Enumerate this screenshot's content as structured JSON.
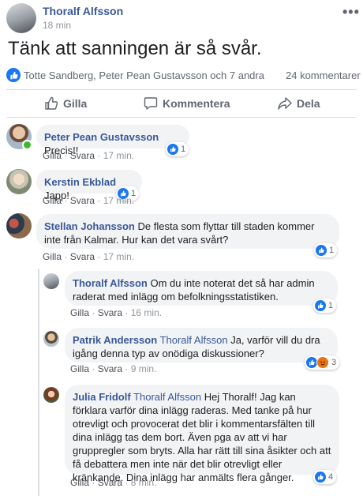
{
  "post": {
    "author": "Thoralf Alfsson",
    "time": "18 min",
    "text": "Tänk att sanningen är så svår.",
    "reactions_summary": "Totte Sandberg, Peter Pean Gustavsson och 7 andra",
    "comments_count": "24 kommentarer",
    "more_icon": "ellipsis-icon"
  },
  "actions": {
    "like": "Gilla",
    "comment": "Kommentera",
    "share": "Dela"
  },
  "comment_links": {
    "like": "Gilla",
    "reply": "Svara",
    "sep": "·"
  },
  "comments": [
    {
      "author": "Peter Pean Gustavsson",
      "text": "Precis!!",
      "time": "17 min.",
      "reactions": "1"
    },
    {
      "author": "Kerstin Ekblad",
      "text": "Japp!",
      "time": "17 min.",
      "reactions": "1"
    },
    {
      "author": "Stellan Johansson",
      "text": "De flesta som flyttar till staden kommer inte från Kalmar. Hur kan det vara svårt?",
      "time": "17 min.",
      "reactions": "1"
    }
  ],
  "replies": [
    {
      "author": "Thoralf Alfsson",
      "tag": "",
      "text": "Om du inte noterat det så har admin raderat med inlägg om befolkningsstatistiken.",
      "time": "16 min.",
      "reactions": "1"
    },
    {
      "author": "Patrik Andersson",
      "tag": "Thoralf Alfsson",
      "text": "Ja, varför vill du dra igång denna typ av onödiga diskussioner?",
      "time": "9 min.",
      "reactions": "3"
    },
    {
      "author": "Julia Fridolf",
      "tag": "Thoralf Alfsson",
      "text": "Hej Thoralf! Jag kan förklara varför dina inlägg raderas. Med tanke på hur otrevligt och provocerat det blir i kommentarsfälten till dina inlägg tas dem bort. Även pga av att vi har gruppregler som bryts. Alla har rätt till sina åsikter och att få debattera men inte när det blir otrevligt eller kränkande. Dina inlägg har anmälts flera gånger.",
      "time": "8 min.",
      "reactions": "4"
    }
  ],
  "colors": {
    "brand": "#385898",
    "like": "#1877f2",
    "angry": "#e9710f",
    "bubble": "#f2f3f5"
  }
}
